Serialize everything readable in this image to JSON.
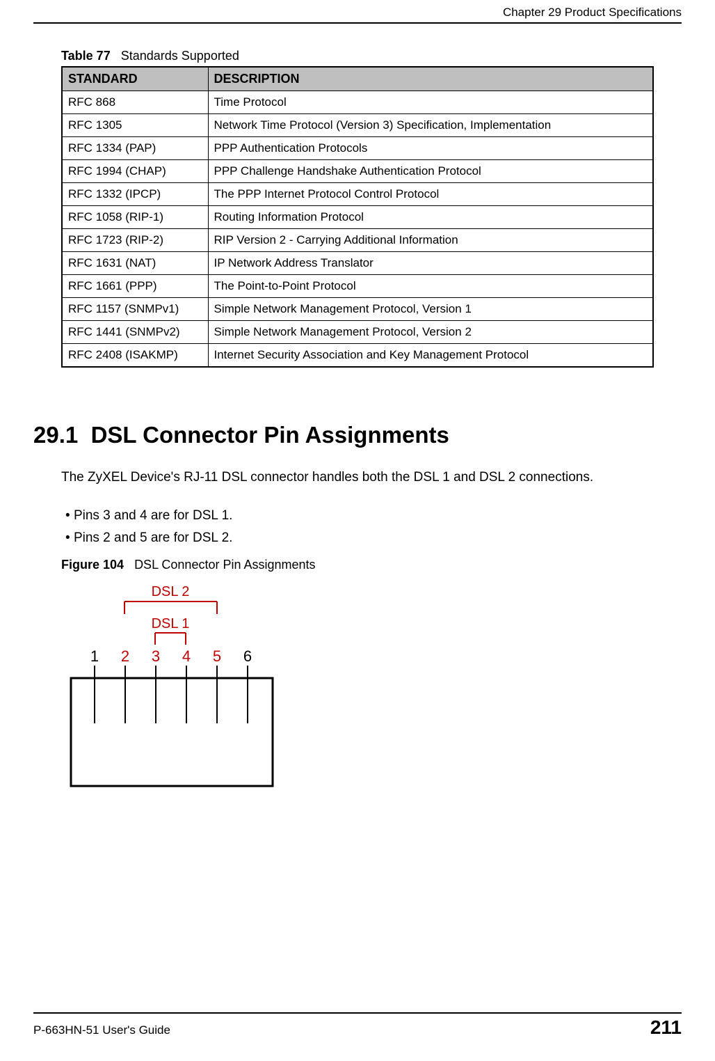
{
  "header": {
    "chapter": "Chapter 29 Product Specifications"
  },
  "table_caption": {
    "label": "Table 77",
    "title": "Standards Supported"
  },
  "table": {
    "headers": {
      "c1": "STANDARD",
      "c2": "DESCRIPTION"
    },
    "rows": [
      {
        "standard": "RFC 868",
        "description": "Time Protocol"
      },
      {
        "standard": "RFC 1305",
        "description": "Network Time Protocol (Version 3) Specification, Implementation"
      },
      {
        "standard": "RFC 1334 (PAP)",
        "description": "PPP Authentication Protocols"
      },
      {
        "standard": "RFC 1994 (CHAP)",
        "description": "PPP Challenge Handshake Authentication Protocol"
      },
      {
        "standard": "RFC 1332 (IPCP)",
        "description": "The PPP Internet Protocol Control Protocol"
      },
      {
        "standard": "RFC 1058 (RIP-1)",
        "description": "Routing Information Protocol"
      },
      {
        "standard": "RFC 1723 (RIP-2)",
        "description": "RIP Version 2 - Carrying Additional Information"
      },
      {
        "standard": "RFC 1631 (NAT)",
        "description": "IP Network Address Translator"
      },
      {
        "standard": "RFC 1661 (PPP)",
        "description": "The Point-to-Point Protocol"
      },
      {
        "standard": "RFC 1157 (SNMPv1)",
        "description": "Simple Network Management Protocol, Version 1"
      },
      {
        "standard": "RFC 1441 (SNMPv2)",
        "description": "Simple Network Management Protocol, Version 2"
      },
      {
        "standard": "RFC 2408  (ISAKMP)",
        "description": "Internet Security Association and Key Management Protocol"
      }
    ]
  },
  "section": {
    "number": "29.1",
    "title": "DSL Connector Pin Assignments"
  },
  "body": "The ZyXEL Device's RJ-11 DSL connector handles both the DSL 1 and DSL 2 connections.",
  "bullets": [
    "Pins 3 and 4 are for DSL 1.",
    "Pins 2 and 5 are for DSL 2."
  ],
  "figure_caption": {
    "label": "Figure 104",
    "title": "DSL Connector Pin Assignments"
  },
  "diagram": {
    "dsl2_label": "DSL 2",
    "dsl1_label": "DSL 1",
    "pins": [
      "1",
      "2",
      "3",
      "4",
      "5",
      "6"
    ],
    "dsl1_pins": [
      3,
      4
    ],
    "dsl2_pins": [
      2,
      5
    ],
    "red_color": "#c00000"
  },
  "footer": {
    "guide": "P-663HN-51 User's Guide",
    "page": "211"
  }
}
